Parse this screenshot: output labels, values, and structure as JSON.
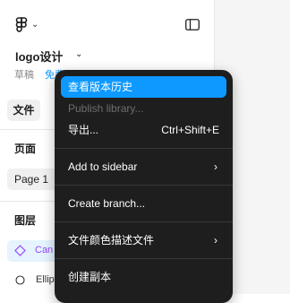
{
  "sidebar": {
    "file_name": "logo设计",
    "location": "草稿",
    "plan_badge": "免费",
    "file_tab_label": "文件",
    "pages_title": "页面",
    "current_page": "Page 1",
    "layers_title": "图层",
    "layers": [
      {
        "name": "Can",
        "icon": "component-diamond-icon",
        "selected": true
      },
      {
        "name": "Ellip",
        "icon": "ellipse-icon",
        "selected": false
      }
    ]
  },
  "menu": {
    "items": [
      {
        "label": "查看版本历史",
        "state": "active"
      },
      {
        "label": "Publish library...",
        "state": "disabled"
      },
      {
        "label": "导出...",
        "shortcut": "Ctrl+Shift+E"
      },
      {
        "label": "Add to sidebar",
        "submenu": "›"
      },
      {
        "label": "Create branch..."
      },
      {
        "label": "文件颜色描述文件",
        "submenu": "›"
      },
      {
        "label": "创建副本"
      }
    ]
  },
  "colors": {
    "accent": "#0d99ff",
    "menu_bg": "#1e1e1e",
    "component_purple": "#9747ff"
  }
}
